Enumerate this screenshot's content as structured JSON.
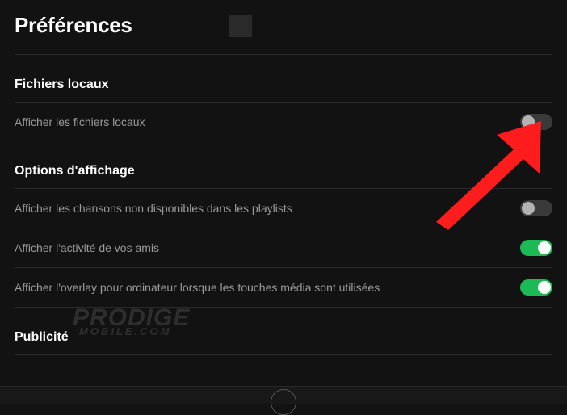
{
  "header": {
    "title": "Préférences"
  },
  "sections": {
    "local_files": {
      "title": "Fichiers locaux",
      "row1_label": "Afficher les fichiers locaux",
      "row1_on": false
    },
    "display": {
      "title": "Options d'affichage",
      "row1_label": "Afficher les chansons non disponibles dans les playlists",
      "row1_on": false,
      "row2_label": "Afficher l'activité de vos amis",
      "row2_on": true,
      "row3_label": "Afficher l'overlay pour ordinateur lorsque les touches média sont utilisées",
      "row3_on": true
    },
    "ads": {
      "title": "Publicité"
    }
  },
  "watermark": {
    "line1": "PRODIGE",
    "line2": "MOBILE.COM"
  },
  "colors": {
    "accent_on": "#1db954",
    "accent_off": "#3a3a3a",
    "arrow": "#ff0000"
  }
}
